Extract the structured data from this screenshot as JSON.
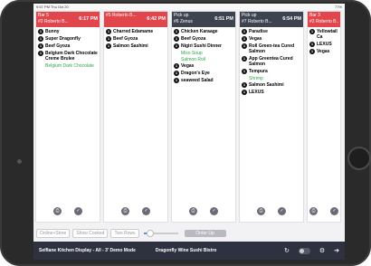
{
  "status": {
    "left": "9:57 PM  Thu Oct 20",
    "right": "77%"
  },
  "colors": {
    "red": "#e0464c",
    "dark": "#3d4450",
    "green": "#2fa84a"
  },
  "tickets": [
    {
      "header_line1": "Bar 5",
      "header_line2": "#2 Roberto B...",
      "time": "6:17 PM",
      "color": "#e0464c",
      "items": [
        {
          "qty": "1",
          "name": "Bunny"
        },
        {
          "qty": "1",
          "name": "Super Dragonfly"
        },
        {
          "qty": "1",
          "name": "Beef Gyoza"
        },
        {
          "qty": "1",
          "name": "Belgium Dark Chocolate Creme Brulee",
          "mods": [
            "Belgium Dark Chocolate"
          ]
        }
      ]
    },
    {
      "header_line1": "",
      "header_line2": "#5 Roberto B...",
      "time": "6:42 PM",
      "color": "#e0464c",
      "items": [
        {
          "qty": "1",
          "name": "Charred Edamame"
        },
        {
          "qty": "1",
          "name": "Beef Gyoza"
        },
        {
          "qty": "1",
          "name": "Salmon Sashimi"
        }
      ]
    },
    {
      "header_line1": "Pick up",
      "header_line2": "#6 Zenus",
      "time": "6:51 PM",
      "color": "#3d4450",
      "items": [
        {
          "qty": "1",
          "name": "Chicken Karaage"
        },
        {
          "qty": "1",
          "name": "Beef Gyoza"
        },
        {
          "qty": "1",
          "name": "Nigiri Sushi Dinner",
          "mods": [
            "Miso Soup",
            "Salmon Roll"
          ]
        },
        {
          "qty": "1",
          "name": "Vegas"
        },
        {
          "qty": "1",
          "name": "Dragon's Eye"
        },
        {
          "qty": "1",
          "name": "seaweed Salad"
        }
      ]
    },
    {
      "header_line1": "Pick up",
      "header_line2": "#7 Roberto B...",
      "time": "6:54 PM",
      "color": "#3d4450",
      "items": [
        {
          "qty": "1",
          "name": "Paradise"
        },
        {
          "qty": "1",
          "name": "Vegas"
        },
        {
          "qty": "1",
          "name": "Roll Green-tea Cured Salmon"
        },
        {
          "qty": "1",
          "name": "App Greentea Cured Salmon"
        },
        {
          "qty": "1",
          "name": "Tempura",
          "mods": [
            "Shrimp"
          ]
        },
        {
          "qty": "1",
          "name": "Salmon Sashimi"
        },
        {
          "qty": "1",
          "name": "LEXUS"
        }
      ]
    },
    {
      "header_line1": "Bar 3",
      "header_line2": "#2 Roberto B...",
      "time": "",
      "color": "#e0464c",
      "items": [
        {
          "qty": "1",
          "name": "Yellowtail Ca"
        },
        {
          "qty": "1",
          "name": "LEXUS"
        },
        {
          "qty": "1",
          "name": "Vegas"
        }
      ]
    }
  ],
  "toolbar": {
    "online_store": "Online+Store",
    "show_cooked": "Show Cooked",
    "two_rows": "Two Rows",
    "order_up": "Order Up",
    "slider_level": 0.2
  },
  "bottombar": {
    "app_name": "Selflane Kitchen Display - All - 3' Demo Mode",
    "venue": "Dragonfly Wine Sushi Bistro"
  },
  "icons": [
    "print-icon",
    "check-icon",
    "refresh-icon",
    "gear-icon",
    "logout-icon"
  ]
}
